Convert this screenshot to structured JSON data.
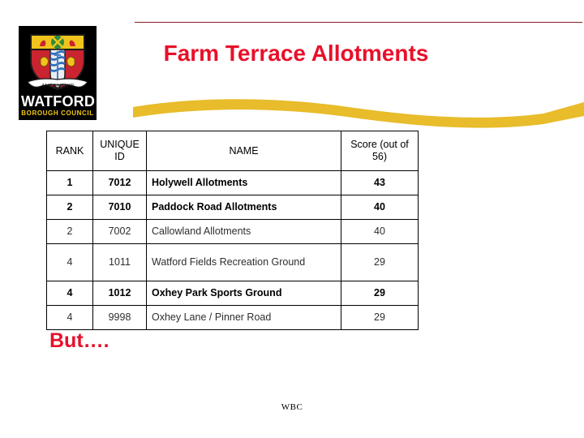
{
  "slide": {
    "title": "Farm Terrace Allotments",
    "callout": "But….",
    "footer": "WBC",
    "colors": {
      "title_red": "#e8102a",
      "rule_red": "#8b1a27",
      "swoosh_gold": "#e8bc2a",
      "logo_black": "#000000",
      "logo_gold": "#f3c915"
    }
  },
  "logo": {
    "name": "WATFORD",
    "subtitle": "BOROUGH COUNCIL",
    "motto": "AUDENTIOR"
  },
  "table": {
    "headers": {
      "rank": "RANK",
      "unique_id": "UNIQUE ID",
      "name": "NAME",
      "score": "Score (out of 56)"
    },
    "rows": [
      {
        "rank": "1",
        "unique_id": "7012",
        "name": "Holywell Allotments",
        "score": "43",
        "emphasis": "bold",
        "height": "normal"
      },
      {
        "rank": "2",
        "unique_id": "7010",
        "name": "Paddock Road Allotments",
        "score": "40",
        "emphasis": "bold",
        "height": "normal"
      },
      {
        "rank": "2",
        "unique_id": "7002",
        "name": "Callowland Allotments",
        "score": "40",
        "emphasis": "plain",
        "height": "normal"
      },
      {
        "rank": "4",
        "unique_id": "1011",
        "name": "Watford Fields Recreation Ground",
        "score": "29",
        "emphasis": "plain",
        "height": "tall"
      },
      {
        "rank": "4",
        "unique_id": "1012",
        "name": "Oxhey Park Sports Ground",
        "score": "29",
        "emphasis": "bold",
        "height": "normal"
      },
      {
        "rank": "4",
        "unique_id": "9998",
        "name": "Oxhey Lane / Pinner Road",
        "score": "29",
        "emphasis": "plain",
        "height": "normal"
      }
    ]
  }
}
